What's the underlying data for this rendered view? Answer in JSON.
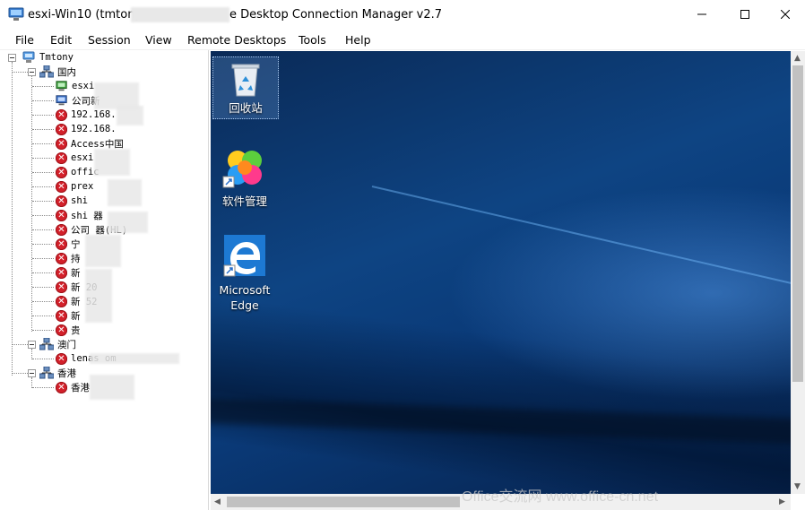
{
  "window": {
    "title_left": "esxi-Win10 (tmtony",
    "title_right": "e Desktop Connection Manager v2.7",
    "minimize_label": "—",
    "maximize_label": "☐",
    "close_label": "✕"
  },
  "menu": {
    "items": [
      "File",
      "Edit",
      "Session",
      "View",
      "Remote Desktops",
      "Tools",
      "Help"
    ]
  },
  "tree": {
    "root": "Tmtony",
    "groups": [
      {
        "label": "国内",
        "items": [
          "esxi",
          "公司新",
          "192.168.",
          "192.168.",
          "Access中国",
          "esxi",
          "offic",
          "prex",
          "shi",
          "shi      器",
          "公司       器(HL)",
          "宁",
          "持",
          "新",
          "新         20",
          "新         52",
          "新",
          "贵"
        ]
      },
      {
        "label": "澳门",
        "items": [
          "lenas                  om"
        ]
      },
      {
        "label": "香港",
        "items": [
          "香港"
        ]
      }
    ]
  },
  "desktop": {
    "icons": [
      {
        "label": "回收站",
        "icon": "recycle-bin-icon"
      },
      {
        "label": "软件管理",
        "icon": "software-manager-icon"
      },
      {
        "label": "Microsoft Edge",
        "icon": "edge-icon"
      }
    ]
  },
  "watermark": "Office交流网 www.office-cn.net",
  "colors": {
    "error": "#d3202a",
    "desktop_blue": "#0e4483",
    "edge_blue": "#1d79d3"
  }
}
